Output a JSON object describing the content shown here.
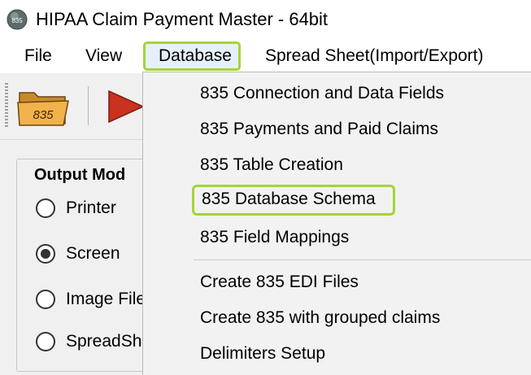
{
  "window": {
    "title": "HIPAA Claim Payment Master - 64bit"
  },
  "menubar": {
    "file": "File",
    "view": "View",
    "database": "Database",
    "spreadsheet": "Spread Sheet(Import/Export)"
  },
  "toolbar": {
    "folder_label": "835"
  },
  "output_mode": {
    "title": "Output Mod",
    "options": [
      {
        "label": "Printer",
        "checked": false
      },
      {
        "label": "Screen",
        "checked": true
      },
      {
        "label": "Image File",
        "checked": false
      },
      {
        "label": "SpreadSh",
        "checked": false
      }
    ]
  },
  "database_menu": {
    "items": [
      "835 Connection and Data Fields",
      "835 Payments and Paid Claims",
      "835 Table Creation",
      "835 Database Schema",
      "835 Field Mappings",
      "Create 835 EDI Files",
      "Create 835 with grouped claims",
      "Delimiters Setup"
    ]
  },
  "colors": {
    "highlight_outline": "#a4d436",
    "menu_active_bg": "#e5f0fb",
    "play_icon": "#c8321e"
  }
}
